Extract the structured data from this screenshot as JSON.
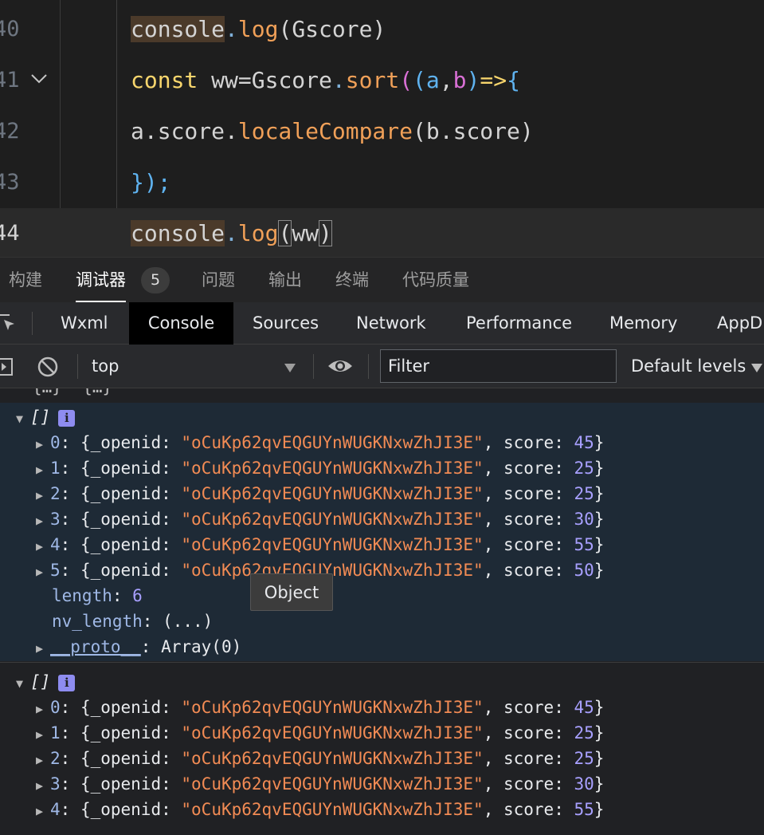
{
  "editor": {
    "lines": [
      {
        "num": "40"
      },
      {
        "num": "41"
      },
      {
        "num": "42"
      },
      {
        "num": "43"
      },
      {
        "num": "44"
      }
    ],
    "tokens": {
      "console": "console",
      "dot": ".",
      "log": "log",
      "lparen": "(",
      "rparen": ")",
      "gscore": "Gscore",
      "const": "const",
      "ww_assign": " ww=",
      "sort": "sort",
      "a": "a",
      "comma": ",",
      "b": "b",
      "arrow": "=>",
      "lbrace": "{",
      "score_a": "a.score.",
      "localeCompare": "localeCompare",
      "b_score": "b.score",
      "close": "});",
      "ww": "ww"
    }
  },
  "panel_tabs": [
    {
      "label": "构建"
    },
    {
      "label": "调试器",
      "active": true
    },
    {
      "label": "问题"
    },
    {
      "label": "输出"
    },
    {
      "label": "终端"
    },
    {
      "label": "代码质量"
    }
  ],
  "panel_badge": "5",
  "devtools_tabs": [
    {
      "label": "Wxml"
    },
    {
      "label": "Console",
      "active": true
    },
    {
      "label": "Sources"
    },
    {
      "label": "Network"
    },
    {
      "label": "Performance"
    },
    {
      "label": "Memory"
    },
    {
      "label": "AppD"
    }
  ],
  "console_toolbar": {
    "context": "top",
    "filter_placeholder": "Filter",
    "levels": "Default levels"
  },
  "console": {
    "array_label": "[]",
    "openid": "\"oCuKp62qvEQGUYnWUGKNxwZhJI3E\"",
    "item_prefix": "{_openid: ",
    "score_key": ", score: ",
    "close_brace": "}",
    "first_group": {
      "items": [
        {
          "index": "0",
          "score": "45"
        },
        {
          "index": "1",
          "score": "25"
        },
        {
          "index": "2",
          "score": "25"
        },
        {
          "index": "3",
          "score": "30"
        },
        {
          "index": "4",
          "score": "55"
        },
        {
          "index": "5",
          "score": "50"
        }
      ],
      "length_key": "length",
      "length_value": "6",
      "nv_length_key": "nv_length",
      "nv_length_value": "(...)",
      "proto_key": "__proto__",
      "proto_value": "Array(0)"
    },
    "second_group": {
      "items": [
        {
          "index": "0",
          "score": "45"
        },
        {
          "index": "1",
          "score": "25"
        },
        {
          "index": "2",
          "score": "25"
        },
        {
          "index": "3",
          "score": "30"
        },
        {
          "index": "4",
          "score": "55"
        }
      ]
    },
    "tooltip": "Object"
  },
  "colors": {
    "string": "#f28b54",
    "number": "#a8a0ff",
    "key": "#9fb8e6",
    "keyword": "#f8d66d",
    "function": "#f0a058"
  }
}
